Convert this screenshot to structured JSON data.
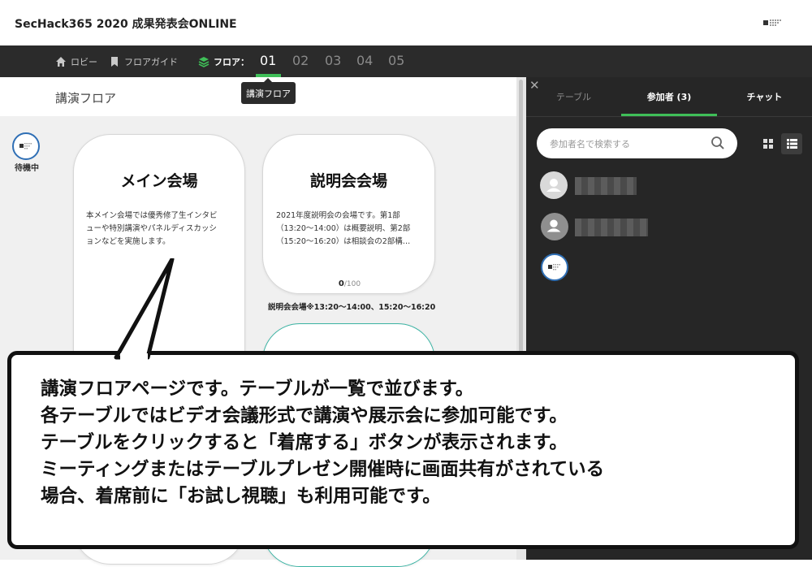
{
  "app": {
    "title": "SecHack365 2020 成果発表会ONLINE"
  },
  "nav": {
    "lobby": "ロビー",
    "floor_guide": "フロアガイド",
    "floor_label": "フロア：",
    "floors": [
      "01",
      "02",
      "03",
      "04",
      "05"
    ],
    "active_floor": "01"
  },
  "main": {
    "floor_title": "講演フロア",
    "tooltip": "講演フロア",
    "waiting_label": "待機中"
  },
  "cards": [
    {
      "title": "メイン会場",
      "desc_lines": [
        "本メイン会場では優秀修了生インタビ",
        "ューや特別講演やパネルディスカッシ",
        "ョンなどを実施します。"
      ]
    },
    {
      "title": "説明会会場",
      "desc_lines": [
        "2021年度説明会の会場です。第1部",
        "（13:20〜14:00）は概要説明、第2部",
        "（15:20〜16:20）は相談会の2部構…"
      ],
      "count": "0",
      "max": "/100",
      "caption": "説明会会場※13:20〜14:00、15:20〜16:20"
    }
  ],
  "panel": {
    "close": "✕",
    "tabs": {
      "table": "テーブル",
      "participants": "参加者 (3)",
      "chat": "チャット"
    },
    "search_placeholder": "参加者名で検索する"
  },
  "bubble": {
    "lines": [
      "講演フロアページです。テーブルが一覧で並びます。",
      "各テーブルではビデオ会議形式で講演や展示会に参加可能です。",
      "テーブルをクリックすると「着席する」ボタンが表示されます。",
      "ミーティングまたはテーブルプレゼン開催時に画面共有がされている",
      "場合、着席前に「お試し視聴」も利用可能です。"
    ]
  },
  "colors": {
    "accent_green": "#3fbf58",
    "navbar": "#2b2b2b",
    "panel": "#262626",
    "avatar_ring": "#2f6fb5"
  }
}
